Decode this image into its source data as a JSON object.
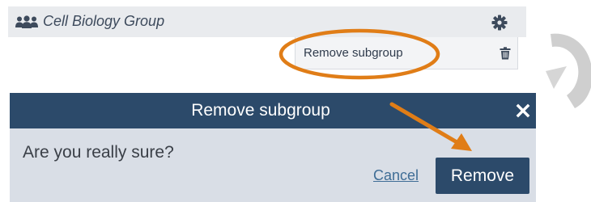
{
  "group": {
    "name": "Cell Biology Group",
    "icon": "users-icon",
    "settings_icon": "gear-icon"
  },
  "menu": {
    "items": [
      {
        "label": "Remove subgroup",
        "icon": "trash-icon"
      }
    ]
  },
  "dialog": {
    "title": "Remove subgroup",
    "close_icon": "close-icon",
    "question": "Are you really sure?",
    "cancel_label": "Cancel",
    "confirm_label": "Remove"
  },
  "colors": {
    "header_bar": "#e9ebee",
    "dialog_header": "#2c4a6a",
    "dialog_body": "#d9dee6",
    "annotation": "#e07d17",
    "link": "#3f6d96"
  },
  "annotations": {
    "highlight": "ellipse",
    "pointer": "arrow"
  }
}
